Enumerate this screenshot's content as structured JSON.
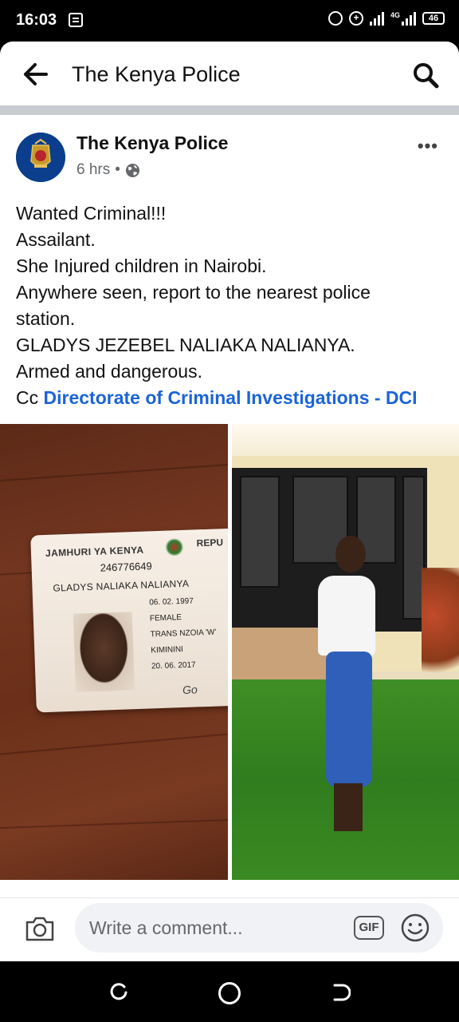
{
  "status_bar": {
    "time": "16:03",
    "network": "4G",
    "battery": "46"
  },
  "app_bar": {
    "title": "The Kenya Police"
  },
  "post": {
    "author": "The Kenya Police",
    "time_ago": "6 hrs",
    "separator": "•",
    "more": "•••",
    "lines": [
      "Wanted Criminal!!!",
      "Assailant.",
      "She Injured children in Nairobi.",
      "Anywhere seen, report to the nearest police",
      "station.",
      "GLADYS JEZEBEL NALIAKA NALIANYA.",
      "Armed and dangerous."
    ],
    "cc_prefix": "Cc",
    "mention": "Directorate of Criminal Investigations - DCI"
  },
  "id_card": {
    "header": "JAMHURI YA KENYA",
    "header_cut": "REPU",
    "serial": "246776649",
    "name": "GLADYS NALIAKA NALIANYA",
    "dob": "06. 02. 1997",
    "sex": "FEMALE",
    "district": "TRANS NZOIA 'W'",
    "place_of_issue": "KIMININI",
    "date_of_issue": "20. 06. 2017",
    "signature": "Go"
  },
  "comment_bar": {
    "placeholder": "Write a comment...",
    "gif_label": "GIF"
  },
  "icons": {
    "back": "arrow-left-icon",
    "search": "search-icon",
    "globe": "globe-icon",
    "camera": "camera-icon",
    "emoji": "emoji-icon"
  },
  "colors": {
    "link": "#1b64d8",
    "meta": "#65676b",
    "divider": "#c9ccd1"
  }
}
